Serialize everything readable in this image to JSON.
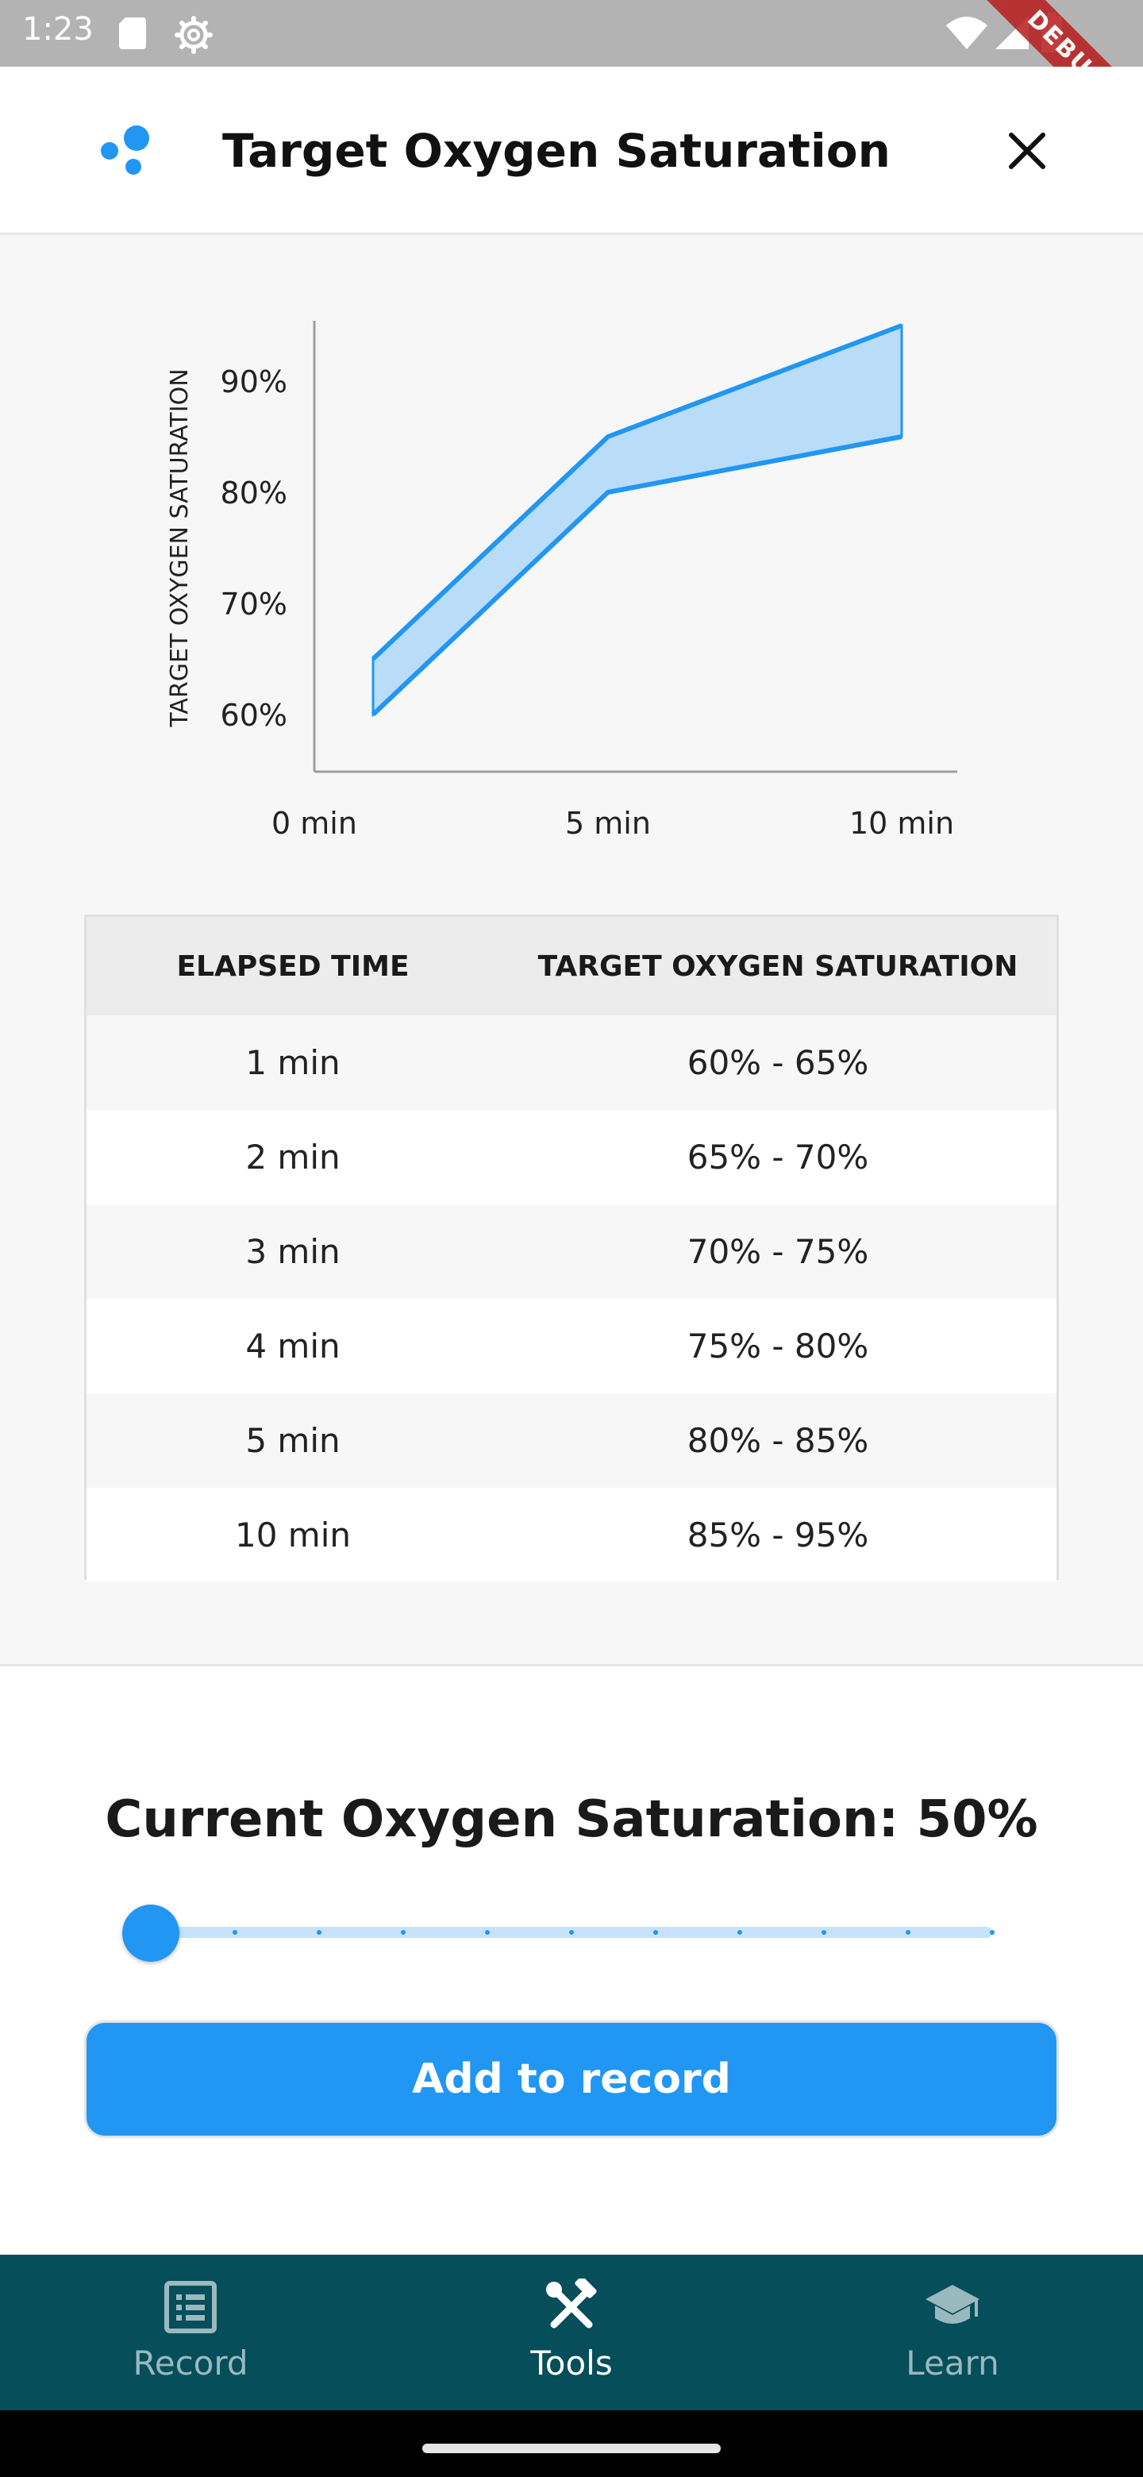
{
  "status_bar": {
    "time": "1:23",
    "debug_label": "DEBUG"
  },
  "header": {
    "title": "Target Oxygen Saturation",
    "logo_icon": "bubbles-logo-icon",
    "close_icon": "close-icon"
  },
  "chart_data": {
    "type": "area",
    "ylabel": "TARGET OXYGEN SATURATION",
    "xlabel": "",
    "x_ticks": [
      "0 min",
      "5 min",
      "10 min"
    ],
    "y_ticks": [
      "60%",
      "70%",
      "80%",
      "90%"
    ],
    "x_values": [
      1,
      5,
      10
    ],
    "lower": [
      60,
      80,
      85
    ],
    "upper": [
      65,
      85,
      95
    ],
    "xlim": [
      0,
      11
    ],
    "ylim": [
      55,
      95
    ],
    "grid": false,
    "color": "#2196f3",
    "fill_color": "#b9dcf8"
  },
  "table": {
    "headers": [
      "ELAPSED TIME",
      "TARGET OXYGEN SATURATION"
    ],
    "rows": [
      [
        "1 min",
        "60% - 65%"
      ],
      [
        "2 min",
        "65% - 70%"
      ],
      [
        "3 min",
        "70% - 75%"
      ],
      [
        "4 min",
        "75% - 80%"
      ],
      [
        "5 min",
        "80% - 85%"
      ],
      [
        "10 min",
        "85% - 95%"
      ]
    ]
  },
  "current": {
    "label": "Current Oxygen Saturation: 50%",
    "slider_value_fraction": 0,
    "slider_divisions": 10
  },
  "actions": {
    "add_label": "Add to record"
  },
  "bottom_nav": {
    "items": [
      {
        "label": "Record",
        "icon": "list-icon",
        "active": false
      },
      {
        "label": "Tools",
        "icon": "tools-icon",
        "active": true
      },
      {
        "label": "Learn",
        "icon": "school-icon",
        "active": false
      }
    ]
  },
  "colors": {
    "accent": "#2196f3",
    "nav_background": "#054e5a"
  }
}
